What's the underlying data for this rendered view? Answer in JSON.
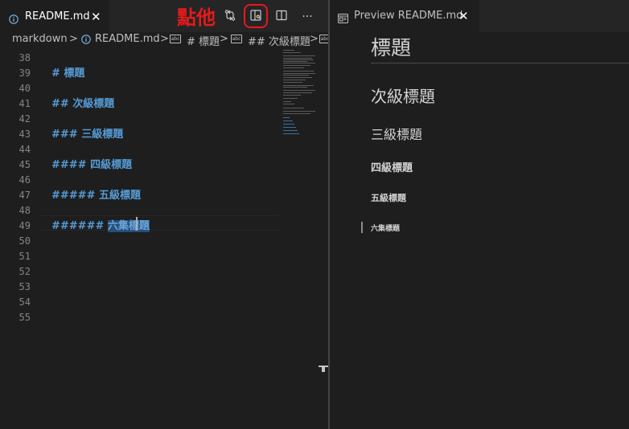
{
  "annotation": {
    "text": "點他",
    "color": "#e51a1a"
  },
  "editor": {
    "tab": {
      "label": "README.md",
      "close": "✕"
    },
    "toolbar": {
      "open_changes": "git-compare-icon",
      "open_preview_side": "open-preview-icon",
      "split_editor": "split-editor-icon",
      "more": "···"
    },
    "breadcrumbs": {
      "items": [
        "markdown",
        "README.md",
        "# 標題",
        "## 次級標題"
      ],
      "separator": ">"
    },
    "lines": [
      {
        "num": "38",
        "text": ""
      },
      {
        "num": "39",
        "text": "# 標題"
      },
      {
        "num": "40",
        "text": ""
      },
      {
        "num": "41",
        "text": "## 次級標題"
      },
      {
        "num": "42",
        "text": ""
      },
      {
        "num": "43",
        "text": "### 三級標題"
      },
      {
        "num": "44",
        "text": ""
      },
      {
        "num": "45",
        "text": "#### 四級標題"
      },
      {
        "num": "46",
        "text": ""
      },
      {
        "num": "47",
        "text": "##### 五級標題"
      },
      {
        "num": "48",
        "text": ""
      },
      {
        "num": "49",
        "text_prefix": "###### ",
        "text_selected": "六集標題"
      },
      {
        "num": "50",
        "text": ""
      },
      {
        "num": "51",
        "text": ""
      },
      {
        "num": "52",
        "text": ""
      },
      {
        "num": "53",
        "text": ""
      },
      {
        "num": "54",
        "text": ""
      },
      {
        "num": "55",
        "text": ""
      }
    ],
    "colors": {
      "heading": "#569cd6",
      "selection": "#264f78",
      "line_number": "#858585"
    }
  },
  "preview": {
    "tab": {
      "label": "Preview README.md",
      "close": "✕"
    },
    "headings": {
      "h1": "標題",
      "h2": "次級標題",
      "h3": "三級標題",
      "h4": "四級標題",
      "h5": "五級標題",
      "h6": "六集標題"
    }
  }
}
